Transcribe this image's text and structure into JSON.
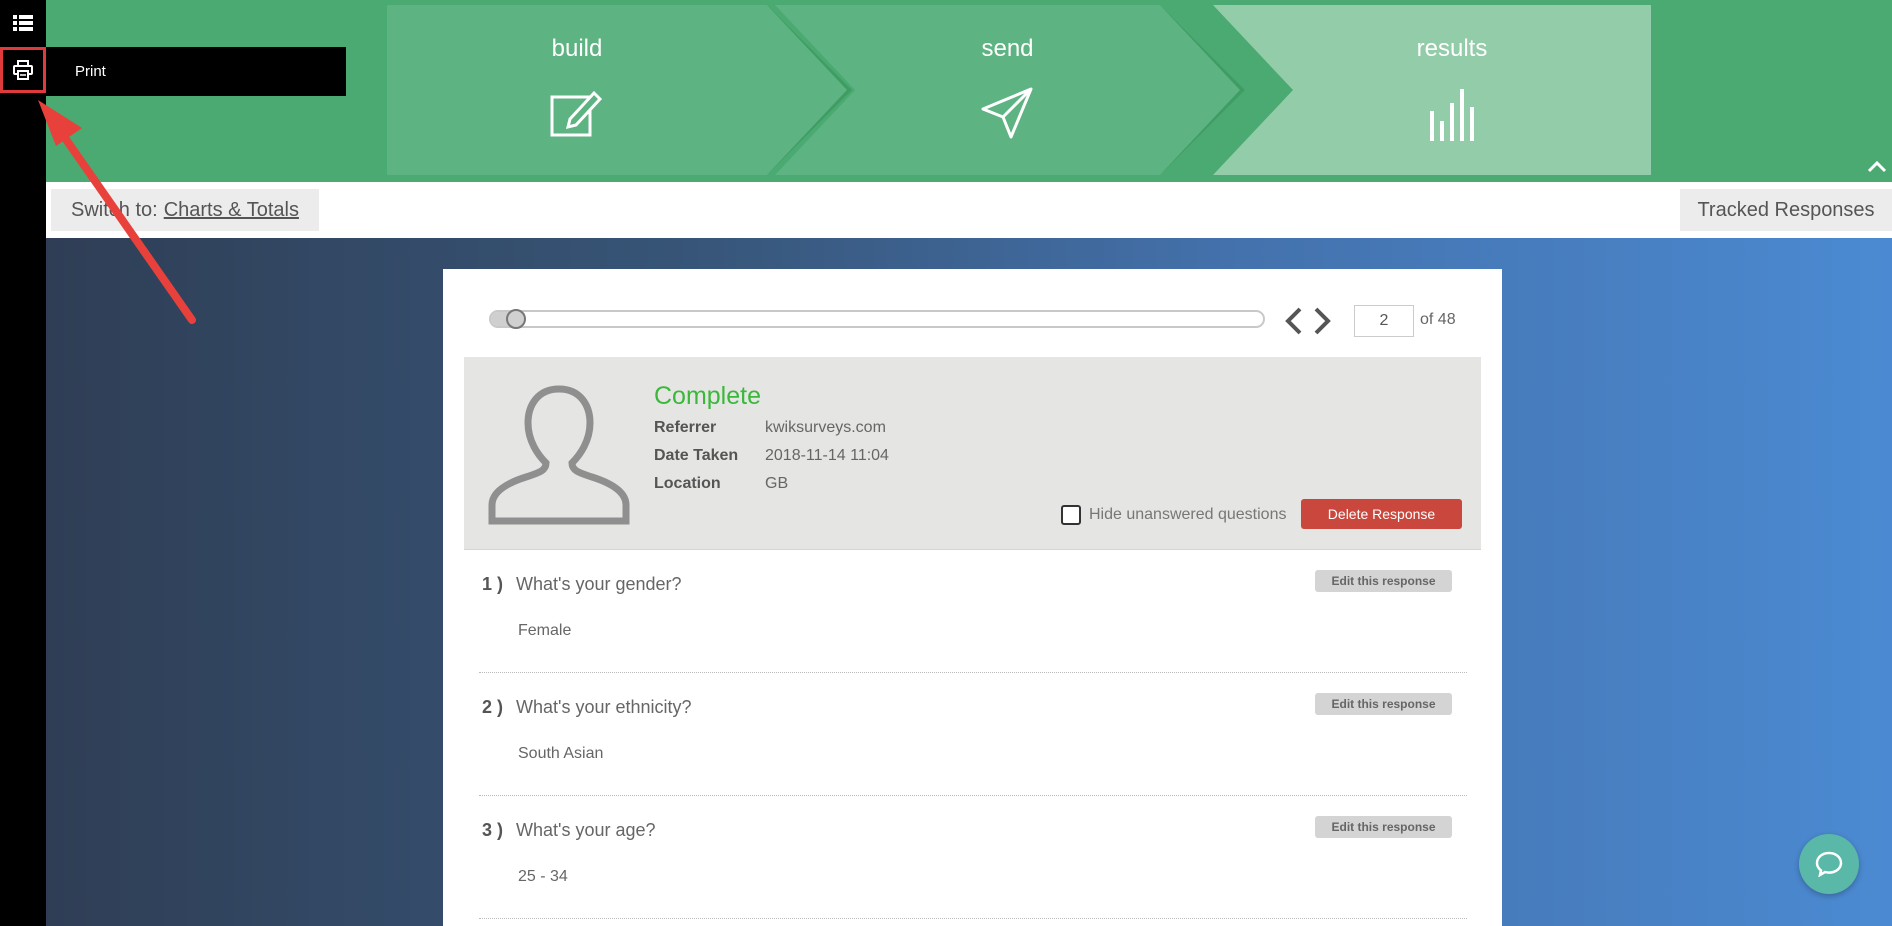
{
  "sidebar": {
    "tooltip": "Print"
  },
  "steps": [
    {
      "label": "build"
    },
    {
      "label": "send"
    },
    {
      "label": "results"
    }
  ],
  "switchbar": {
    "prefix": "Switch to:",
    "link": "Charts & Totals",
    "tracked": "Tracked Responses"
  },
  "navigation": {
    "current_page": "2",
    "total_text": "of 48",
    "progress_fraction": 0.02
  },
  "response": {
    "status": "Complete",
    "meta": [
      {
        "key": "Referrer",
        "value": "kwiksurveys.com"
      },
      {
        "key": "Date Taken",
        "value": "2018-11-14 11:04"
      },
      {
        "key": "Location",
        "value": "GB"
      }
    ],
    "hide_label": "Hide unanswered questions",
    "delete_label": "Delete Response"
  },
  "questions": [
    {
      "num": "1 )",
      "text": "What's your gender?",
      "answer": "Female",
      "edit": "Edit this response"
    },
    {
      "num": "2 )",
      "text": "What's your ethnicity?",
      "answer": "South Asian",
      "edit": "Edit this response"
    },
    {
      "num": "3 )",
      "text": "What's your age?",
      "answer": "25 - 34",
      "edit": "Edit this response"
    }
  ],
  "colors": {
    "header_green": "#4aaa71",
    "status_green": "#3bb83b",
    "delete_red": "#c9473c",
    "highlight_red": "#e03a3a"
  }
}
